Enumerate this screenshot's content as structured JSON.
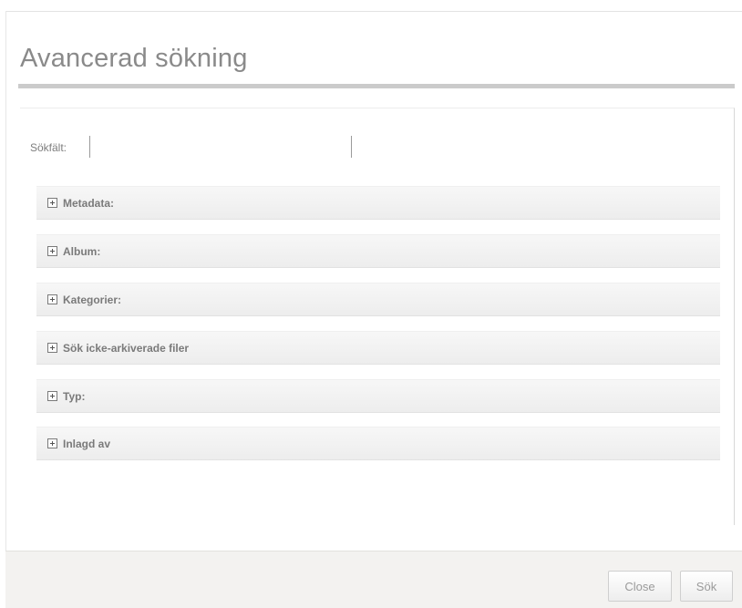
{
  "dialog": {
    "title": "Avancerad sökning"
  },
  "search": {
    "label": "Sökfält:",
    "value": ""
  },
  "sections": [
    {
      "label": "Metadata:"
    },
    {
      "label": "Album:"
    },
    {
      "label": "Kategorier:"
    },
    {
      "label": "Sök icke-arkiverade filer"
    },
    {
      "label": "Typ:"
    },
    {
      "label": "Inlagd av"
    }
  ],
  "footer": {
    "close_label": "Close",
    "search_label": "Sök"
  },
  "colors": {
    "title": "#8a8a8a",
    "section_bg": "#efefef",
    "footer_bg": "#f3f2f0"
  }
}
